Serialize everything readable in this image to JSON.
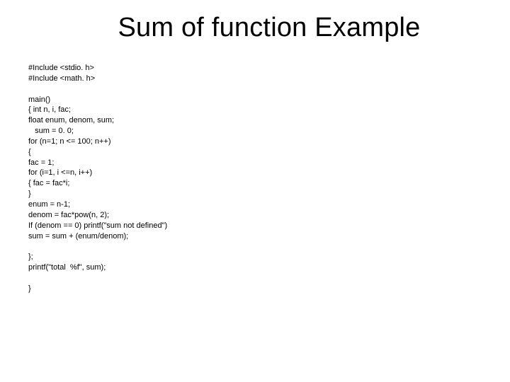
{
  "title": "Sum of function Example",
  "code": "#Include <stdio. h>\n#Include <math. h>\n\nmain()\n{ int n, i, fac;\nfloat enum, denom, sum;\n   sum = 0. 0;\nfor (n=1; n <= 100; n++)\n{\nfac = 1;\nfor (i=1, i <=n, i++)\n{ fac = fac*i;\n}\nenum = n-1;\ndenom = fac*pow(n, 2);\nIf (denom == 0) printf(\"sum not defined\")\nsum = sum + (enum/denom);\n\n};\nprintf(\"total  %f\", sum);\n\n}"
}
